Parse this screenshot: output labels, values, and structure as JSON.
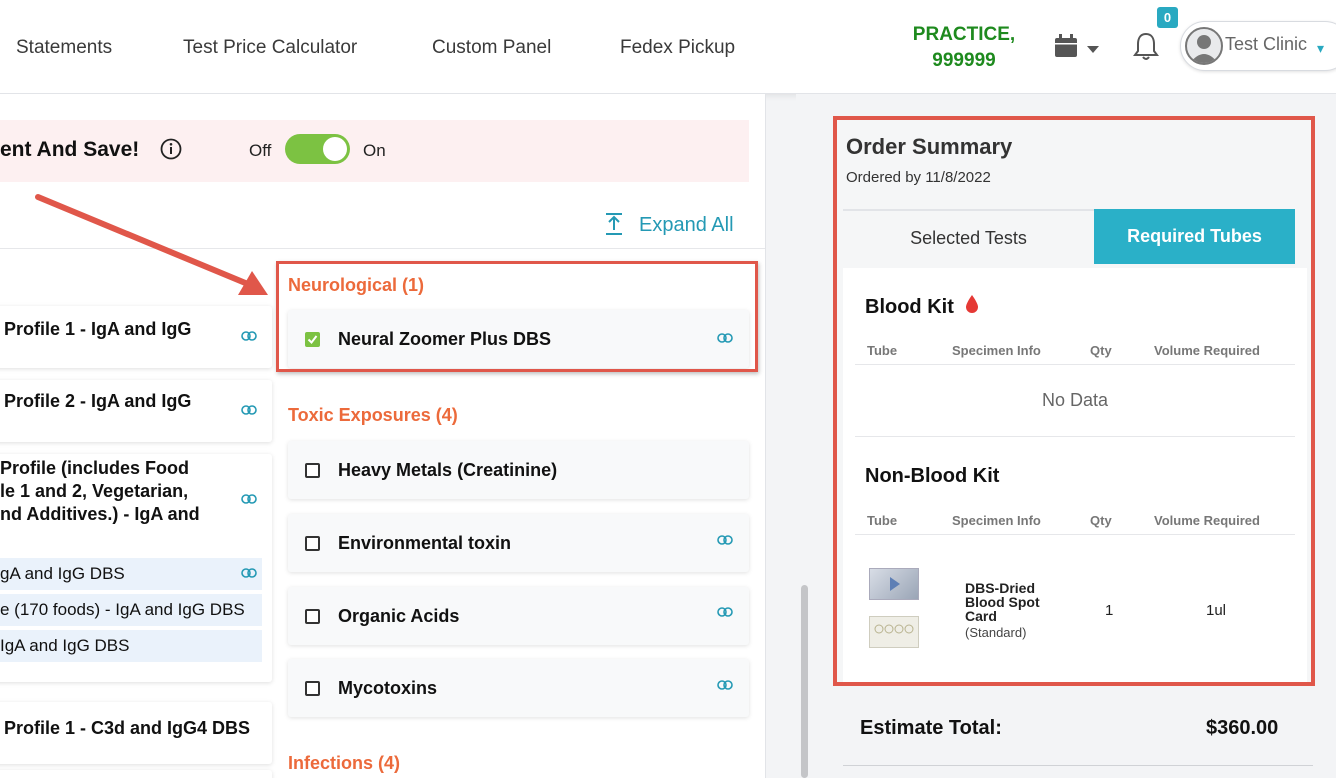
{
  "nav": {
    "items": [
      "Statements",
      "Test Price Calculator",
      "Custom Panel",
      "Fedex Pickup"
    ],
    "practice_line1": "PRACTICE,",
    "practice_line2": "999999",
    "notification_count": "0",
    "user_name": "Test Clinic"
  },
  "promo": {
    "text": "ent And Save!",
    "toggle_off": "Off",
    "toggle_on": "On",
    "toggle_state": "on"
  },
  "expand_all": "Expand All",
  "left_tests": [
    "Profile 1 - IgA and IgG",
    "Profile 2 - IgA and IgG",
    "Profile (includes Food",
    "le 1 and 2, Vegetarian,",
    "nd Additives.) - IgA and",
    "gA and IgG DBS",
    "e (170 foods) - IgA and IgG DBS",
    "IgA and IgG DBS",
    "Profile 1 - C3d and IgG4 DBS"
  ],
  "categories": {
    "neurological": {
      "title": "Neurological (1)",
      "tests": [
        {
          "name": "Neural Zoomer Plus DBS",
          "checked": true
        }
      ]
    },
    "toxic": {
      "title": "Toxic Exposures (4)",
      "tests": [
        {
          "name": "Heavy Metals (Creatinine)",
          "checked": false
        },
        {
          "name": "Environmental toxin",
          "checked": false
        },
        {
          "name": "Organic Acids",
          "checked": false
        },
        {
          "name": "Mycotoxins",
          "checked": false
        }
      ]
    },
    "infections": {
      "title": "Infections (4)"
    }
  },
  "summary": {
    "title": "Order Summary",
    "ordered_by": "Ordered by 11/8/2022",
    "tabs": [
      "Selected Tests",
      "Required Tubes"
    ],
    "active_tab": "Required Tubes",
    "blood_kit": {
      "title": "Blood Kit",
      "columns": [
        "Tube",
        "Specimen Info",
        "Qty",
        "Volume Required"
      ],
      "empty": "No Data"
    },
    "non_blood_kit": {
      "title": "Non-Blood Kit",
      "columns": [
        "Tube",
        "Specimen Info",
        "Qty",
        "Volume Required"
      ],
      "rows": [
        {
          "specimen": "DBS-Dried Blood Spot Card",
          "sub": "(Standard)",
          "qty": "1",
          "volume": "1ul"
        }
      ]
    }
  },
  "estimate": {
    "label": "Estimate Total:",
    "value": "$360.00"
  },
  "colors": {
    "accent": "#2ab0c8",
    "category": "#ec6a3b",
    "highlight": "#e0574a",
    "toggle": "#7cc242",
    "practice": "#1e8a1e"
  }
}
